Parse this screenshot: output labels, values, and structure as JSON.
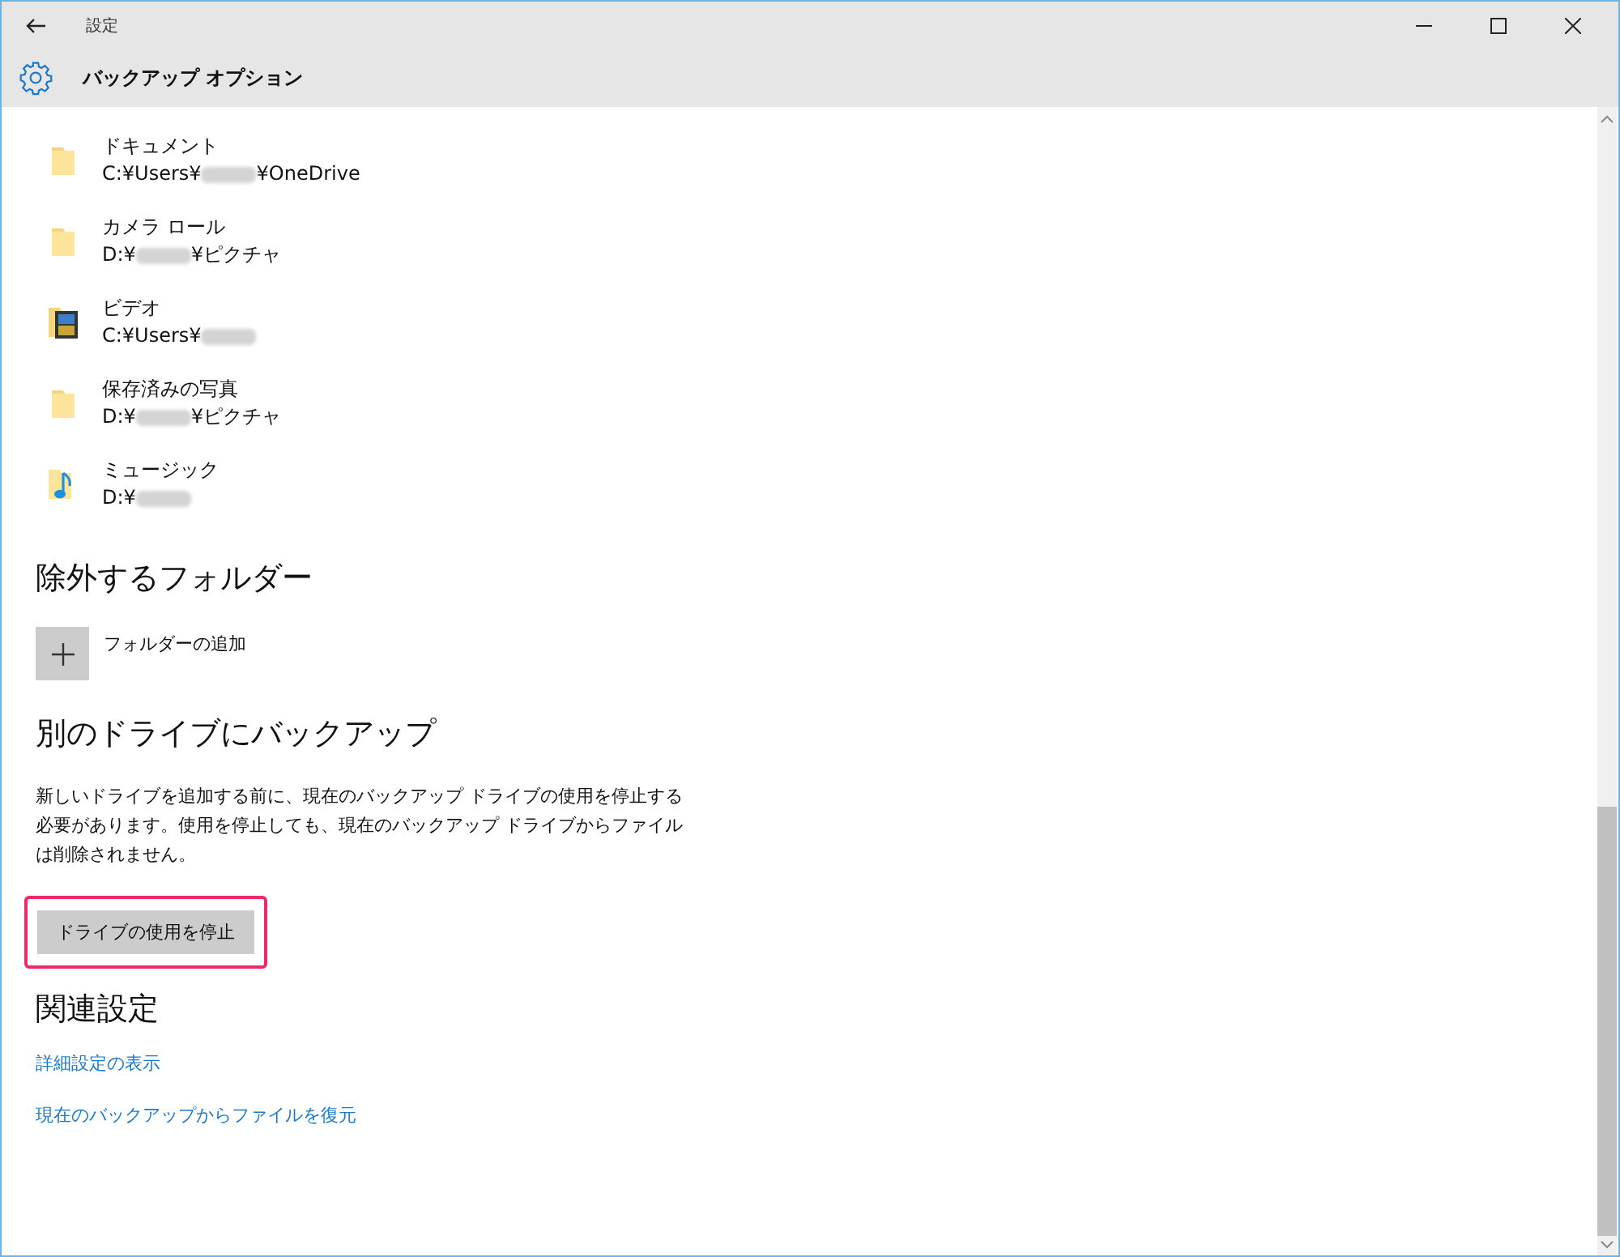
{
  "window": {
    "title": "設定"
  },
  "header": {
    "title": "バックアップ オプション"
  },
  "folders": [
    {
      "kind": "folder",
      "name": "ドキュメント",
      "path_start": "C:¥Users¥",
      "redacted": true,
      "path_end": "¥OneDrive"
    },
    {
      "kind": "folder",
      "name": "カメラ ロール",
      "path_start": "D:¥",
      "redacted": true,
      "path_end": "¥ピクチャ"
    },
    {
      "kind": "video",
      "name": "ビデオ",
      "path_start": "C:¥Users¥",
      "redacted": true
    },
    {
      "kind": "folder",
      "name": "保存済みの写真",
      "path_start": "D:¥",
      "redacted": true,
      "path_end": "¥ピクチャ"
    },
    {
      "kind": "music",
      "name": "ミュージック",
      "path_start": "D:¥",
      "redacted": true
    }
  ],
  "exclude": {
    "heading": "除外するフォルダー",
    "add_label": "フォルダーの追加"
  },
  "other_drive": {
    "heading": "別のドライブにバックアップ",
    "description": "新しいドライブを追加する前に、現在のバックアップ ドライブの使用を停止する必要があります。使用を停止しても、現在のバックアップ ドライブからファイルは削除されません。",
    "button": "ドライブの使用を停止",
    "highlighted": true
  },
  "related": {
    "heading": "関連設定",
    "links": [
      "詳細設定の表示",
      "現在のバックアップからファイルを復元"
    ]
  }
}
